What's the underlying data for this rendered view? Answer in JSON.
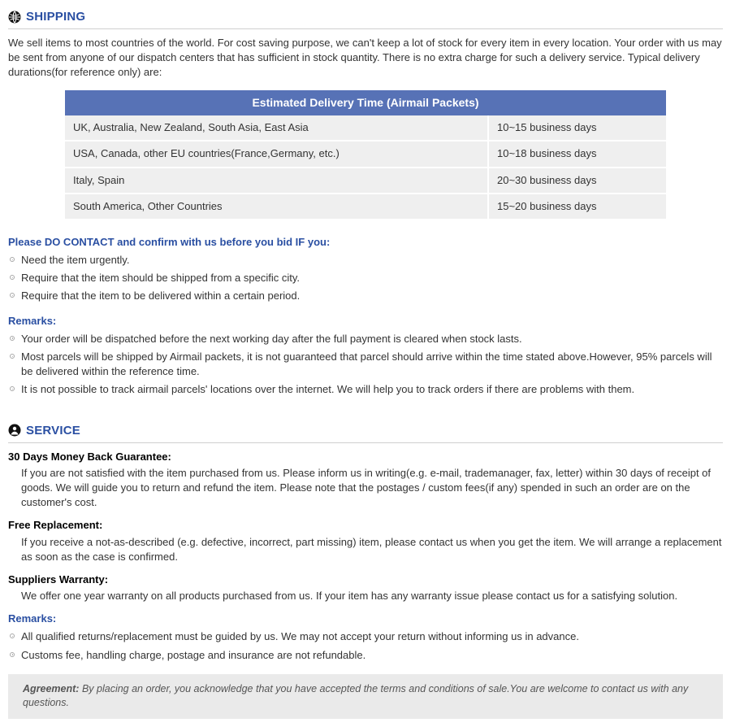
{
  "shipping": {
    "title": "SHIPPING",
    "intro": "We sell items to most countries of the world. For cost saving purpose, we can't keep a lot of stock for every item in every location. Your order with us may be sent from anyone of our dispatch centers that has sufficient in stock quantity. There is no extra charge for such a delivery service. Typical delivery durations(for reference only) are:",
    "table_header": "Estimated Delivery Time (Airmail Packets)",
    "rows": [
      {
        "region": "UK, Australia, New Zealand, South Asia, East Asia",
        "time": "10~15 business days"
      },
      {
        "region": "USA, Canada, other EU countries(France,Germany, etc.)",
        "time": "10~18 business days"
      },
      {
        "region": "Italy, Spain",
        "time": "20~30 business days"
      },
      {
        "region": "South America, Other Countries",
        "time": "15~20 business days"
      }
    ],
    "contact_heading": "Please DO CONTACT and confirm with us before you bid IF you:",
    "contact_bullets": [
      "Need the item urgently.",
      "Require that the item should be shipped from a specific city.",
      "Require that the item to be delivered within a certain period."
    ],
    "remarks_heading": "Remarks:",
    "remarks_bullets": [
      "Your order will be dispatched before the next working day after the full payment is cleared when stock lasts.",
      "Most parcels will be shipped by Airmail packets, it is not guaranteed that parcel should arrive within the time stated above.However, 95% parcels will be delivered within the reference time.",
      "It is not possible to track airmail parcels' locations over the internet. We will help you to track orders if there are problems with them."
    ]
  },
  "service": {
    "title": "SERVICE",
    "blocks": [
      {
        "label": "30 Days Money Back Guarantee:",
        "body": "If you are not satisfied with the item purchased from us. Please inform us in writing(e.g. e-mail, trademanager, fax, letter) within 30 days of receipt of goods. We will guide you to return and refund the item. Please note that the postages / custom fees(if any) spended in such an order are on the customer's cost."
      },
      {
        "label": "Free Replacement:",
        "body": "If you receive a not-as-described (e.g. defective, incorrect, part missing) item, please contact us when you get the item. We will arrange a replacement as soon as the case is confirmed."
      },
      {
        "label": "Suppliers Warranty:",
        "body": "We offer one year warranty on all products purchased from us. If your item has any warranty issue please contact us for a satisfying solution."
      }
    ],
    "remarks_heading": "Remarks:",
    "remarks_bullets": [
      "All qualified returns/replacement must be guided by us. We may not accept your return without informing us in advance.",
      "Customs fee, handling charge, postage and insurance are not refundable."
    ]
  },
  "agreement": {
    "label": "Agreement:",
    "text": "By placing an order, you acknowledge that you have accepted the terms and conditions of sale.You are welcome to contact us with any questions."
  }
}
